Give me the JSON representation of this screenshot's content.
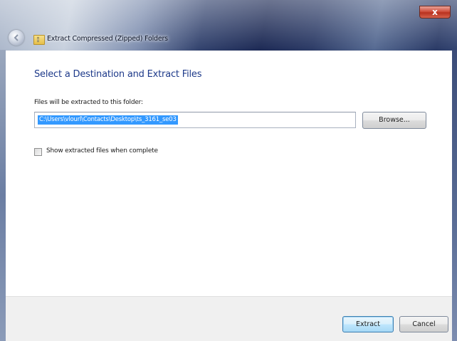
{
  "window": {
    "title": "Extract Compressed (Zipped) Folders",
    "close_label": "x"
  },
  "wizard": {
    "heading": "Select a Destination and Extract Files",
    "destination_label": "Files will be extracted to this folder:",
    "destination_path": "C:\\Users\\vlourl\\Contacts\\Desktop\\ts_3161_se03",
    "browse_label": "Browse...",
    "show_files_label": "Show extracted files when complete",
    "show_files_checked": false
  },
  "footer": {
    "extract_label": "Extract",
    "cancel_label": "Cancel"
  }
}
